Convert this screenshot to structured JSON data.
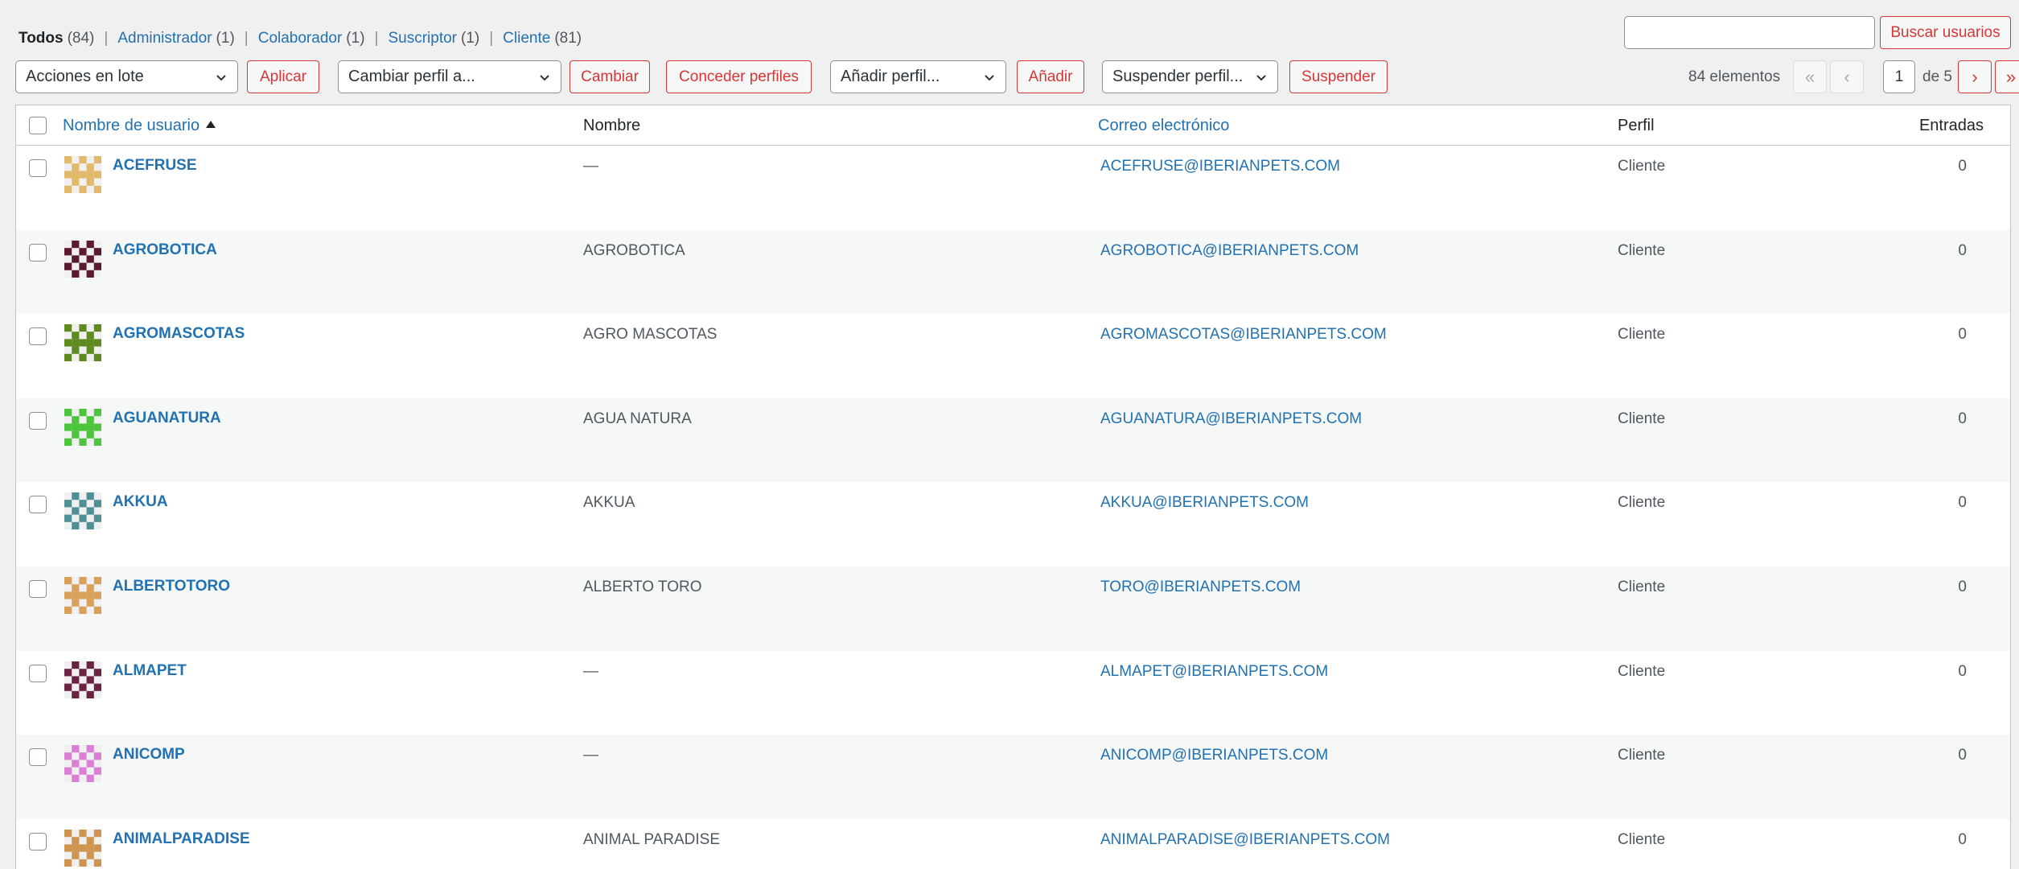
{
  "filters": [
    {
      "label": "Todos",
      "count": "(84)",
      "current": true
    },
    {
      "label": "Administrador",
      "count": "(1)",
      "current": false
    },
    {
      "label": "Colaborador",
      "count": "(1)",
      "current": false
    },
    {
      "label": "Suscriptor",
      "count": "(1)",
      "current": false
    },
    {
      "label": "Cliente",
      "count": "(81)",
      "current": false
    }
  ],
  "search": {
    "value": "",
    "button": "Buscar usuarios"
  },
  "toolbar": {
    "bulk_actions": "Acciones en lote",
    "apply": "Aplicar",
    "change_role": "Cambiar perfil a...",
    "change": "Cambiar",
    "grant_roles": "Conceder perfiles",
    "add_role": "Añadir perfil...",
    "add": "Añadir",
    "suspend_role": "Suspender perfil...",
    "suspend": "Suspender"
  },
  "pagination": {
    "displaying": "84 elementos",
    "first": "«",
    "prev": "‹",
    "current": "1",
    "of": "de 5",
    "next": "›",
    "last": "»"
  },
  "columns": {
    "username": "Nombre de usuario",
    "name": "Nombre",
    "email": "Correo electrónico",
    "role": "Perfil",
    "posts": "Entradas"
  },
  "users": [
    {
      "username": "ACEFRUSE",
      "name": "—",
      "email": "ACEFRUSE@IBERIANPETS.COM",
      "role": "Cliente",
      "posts": "0",
      "avatar_color": "#e2b96a"
    },
    {
      "username": "AGROBOTICA",
      "name": "AGROBOTICA",
      "email": "AGROBOTICA@IBERIANPETS.COM",
      "role": "Cliente",
      "posts": "0",
      "avatar_color": "#5b1a2e"
    },
    {
      "username": "AGROMASCOTAS",
      "name": "AGRO MASCOTAS",
      "email": "AGROMASCOTAS@IBERIANPETS.COM",
      "role": "Cliente",
      "posts": "0",
      "avatar_color": "#5e8a1f"
    },
    {
      "username": "AGUANATURA",
      "name": "AGUA NATURA",
      "email": "AGUANATURA@IBERIANPETS.COM",
      "role": "Cliente",
      "posts": "0",
      "avatar_color": "#4cc43b"
    },
    {
      "username": "AKKUA",
      "name": "AKKUA",
      "email": "AKKUA@IBERIANPETS.COM",
      "role": "Cliente",
      "posts": "0",
      "avatar_color": "#4f8f96"
    },
    {
      "username": "ALBERTOTORO",
      "name": "ALBERTO TORO",
      "email": "TORO@IBERIANPETS.COM",
      "role": "Cliente",
      "posts": "0",
      "avatar_color": "#d9a05b"
    },
    {
      "username": "ALMAPET",
      "name": "—",
      "email": "ALMAPET@IBERIANPETS.COM",
      "role": "Cliente",
      "posts": "0",
      "avatar_color": "#6b2344"
    },
    {
      "username": "ANICOMP",
      "name": "—",
      "email": "ANICOMP@IBERIANPETS.COM",
      "role": "Cliente",
      "posts": "0",
      "avatar_color": "#db7fd6"
    },
    {
      "username": "ANIMALPARADISE",
      "name": "ANIMAL PARADISE",
      "email": "ANIMALPARADISE@IBERIANPETS.COM",
      "role": "Cliente",
      "posts": "0",
      "avatar_color": "#cf9550"
    }
  ]
}
